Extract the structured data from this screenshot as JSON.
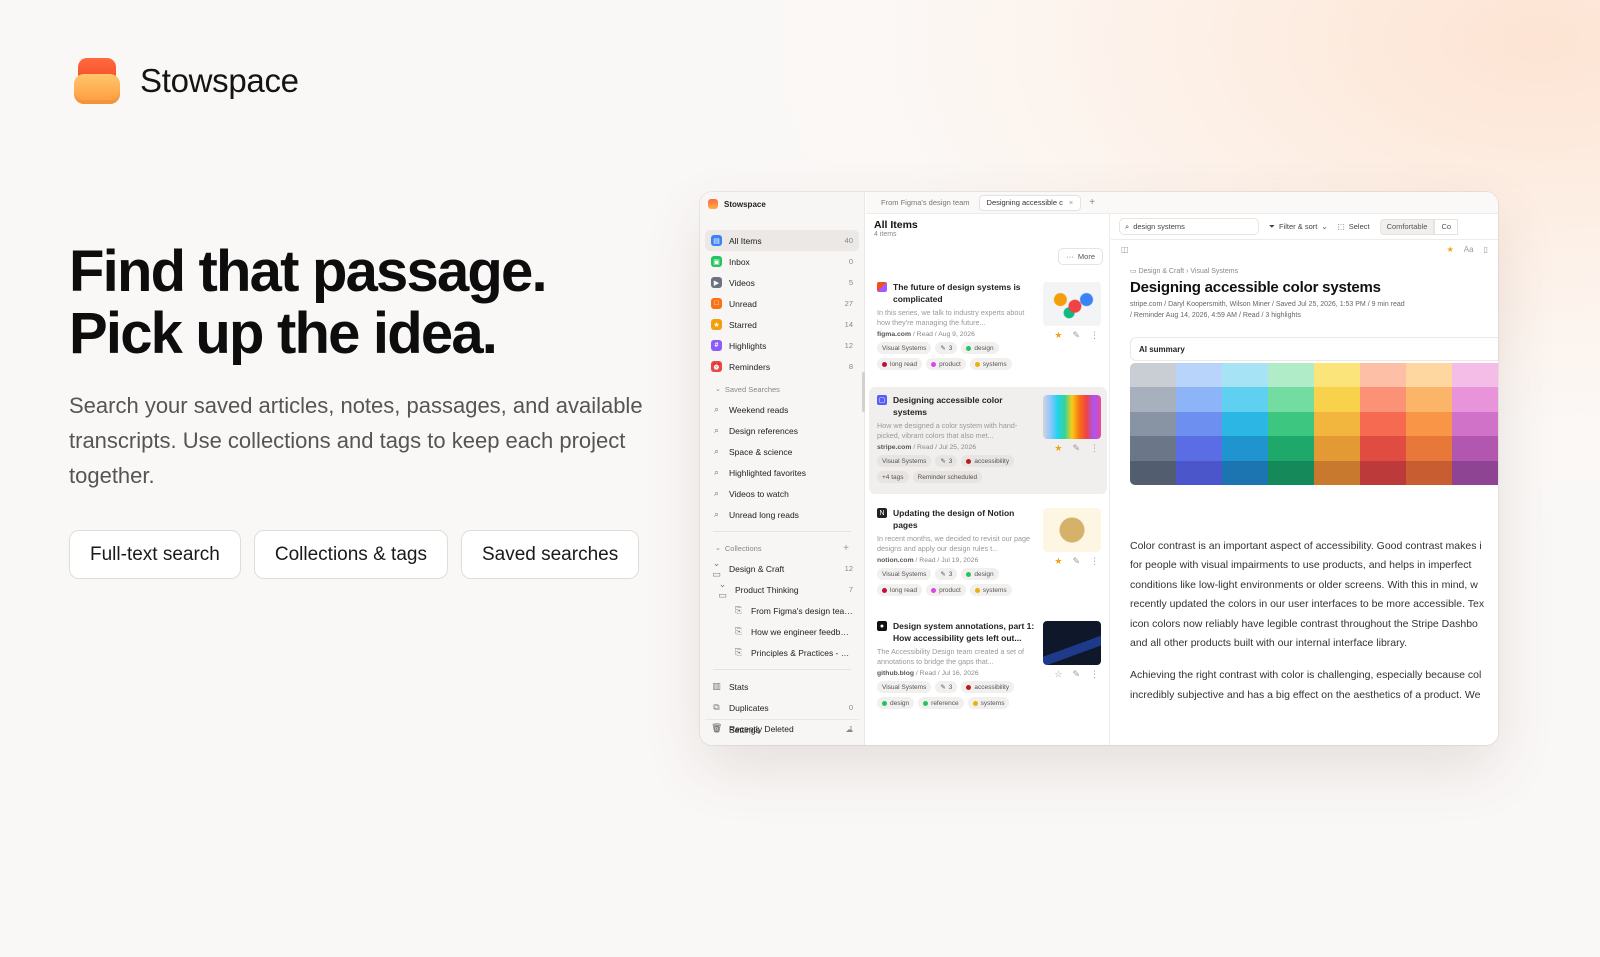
{
  "brand": {
    "name": "Stowspace"
  },
  "hero": {
    "line1": "Find that passage.",
    "line2": "Pick up the idea.",
    "subtitle": "Search your saved articles, notes, passages, and available transcripts. Use collections and tags to keep each project together.",
    "pills": [
      "Full-text search",
      "Collections & tags",
      "Saved searches"
    ]
  },
  "app": {
    "sidebar": {
      "title": "Stowspace",
      "items": [
        {
          "label": "All Items",
          "count": "40",
          "color": "#3b82f6",
          "glyph": "▤"
        },
        {
          "label": "Inbox",
          "count": "0",
          "color": "#22c55e",
          "glyph": "▣"
        },
        {
          "label": "Videos",
          "count": "5",
          "color": "#6b7280",
          "glyph": "▶"
        },
        {
          "label": "Unread",
          "count": "27",
          "color": "#f97316",
          "glyph": "□"
        },
        {
          "label": "Starred",
          "count": "14",
          "color": "#f59e0b",
          "glyph": "★"
        },
        {
          "label": "Highlights",
          "count": "12",
          "color": "#8b5cf6",
          "glyph": "#"
        },
        {
          "label": "Reminders",
          "count": "8",
          "color": "#ef4444",
          "glyph": "⏰"
        }
      ],
      "saved_section": "Saved Searches",
      "saved": [
        "Weekend reads",
        "Design references",
        "Space & science",
        "Highlighted favorites",
        "Videos to watch",
        "Unread long reads"
      ],
      "collections_section": "Collections",
      "collection": {
        "label": "Design & Craft",
        "count": "12"
      },
      "subcollection": {
        "label": "Product Thinking",
        "count": "7"
      },
      "docs": [
        "From Figma's design team:...",
        "How we engineer feedback...",
        "Principles & Practices - Line..."
      ],
      "utilities": [
        {
          "label": "Stats",
          "count": ""
        },
        {
          "label": "Duplicates",
          "count": "0"
        },
        {
          "label": "Recently Deleted",
          "count": "1"
        }
      ],
      "settings": "Settings"
    },
    "tabs": [
      "From Figma's design team",
      "Designing accessible c"
    ],
    "list": {
      "title": "All Items",
      "subtitle": "4 items",
      "more": "More",
      "cards": [
        {
          "title": "The future of design systems is complicated",
          "excerpt": "In this series, we talk to industry experts about how they're managing the future...",
          "domain": "figma.com",
          "meta": " / Read / Aug 9, 2026",
          "tags1": [
            {
              "t": "Visual Systems"
            },
            {
              "t": "3"
            },
            {
              "t": "design",
              "c": "#22c55e"
            }
          ],
          "tags2": [
            {
              "t": "long read",
              "c": "#be123c"
            },
            {
              "t": "product",
              "c": "#d946ef"
            },
            {
              "t": "systems",
              "c": "#eab308"
            }
          ],
          "starred": true
        },
        {
          "title": "Designing accessible color systems",
          "excerpt": "How we designed a color system with hand-picked, vibrant colors that also met...",
          "domain": "stripe.com",
          "meta": " / Read / Jul 25, 2026",
          "tags1": [
            {
              "t": "Visual Systems"
            },
            {
              "t": "3"
            },
            {
              "t": "accessibility",
              "c": "#b91c1c"
            }
          ],
          "tags2": [
            {
              "t": "+4 tags"
            },
            {
              "t": "Reminder scheduled"
            }
          ],
          "starred": true
        },
        {
          "title": "Updating the design of Notion pages",
          "excerpt": "In recent months, we decided to revisit our page designs and apply our design rules t...",
          "domain": "notion.com",
          "meta": " / Read / Jul 19, 2026",
          "tags1": [
            {
              "t": "Visual Systems"
            },
            {
              "t": "3"
            },
            {
              "t": "design",
              "c": "#22c55e"
            }
          ],
          "tags2": [
            {
              "t": "long read",
              "c": "#be123c"
            },
            {
              "t": "product",
              "c": "#d946ef"
            },
            {
              "t": "systems",
              "c": "#eab308"
            }
          ],
          "starred": true
        },
        {
          "title": "Design system annotations, part 1: How accessibility gets left out...",
          "excerpt": "The Accessibility Design team created a set of annotations to bridge the gaps that...",
          "domain": "github.blog",
          "meta": " / Read / Jul 16, 2026",
          "tags1": [
            {
              "t": "Visual Systems"
            },
            {
              "t": "3"
            },
            {
              "t": "accessibility",
              "c": "#b91c1c"
            }
          ],
          "tags2": [
            {
              "t": "design",
              "c": "#22c55e"
            },
            {
              "t": "reference",
              "c": "#22c55e"
            },
            {
              "t": "systems",
              "c": "#eab308"
            }
          ],
          "starred": false
        }
      ]
    },
    "reader": {
      "search_value": "design systems",
      "filter": "Filter & sort",
      "select": "Select",
      "view_on": "Comfortable",
      "view_next": "Co",
      "sub_aa": "Aa",
      "crumb1": "Design & Craft",
      "crumb2": "Visual Systems",
      "title": "Designing accessible color systems",
      "meta_line1": "stripe.com  /   Daryl Koopersmith, Wilson Miner  /   Saved Jul 25, 2026, 1:53 PM  /   9 min read",
      "meta_line2": "/   Reminder Aug 14, 2026, 4:59 AM   /   Read   /   3 highlights",
      "ai_label": "AI summary",
      "para1": [
        "Color contrast is an important aspect of accessibility. Good contrast makes i",
        "for people with visual impairments to use products, and helps in imperfect",
        "conditions like low-light environments or older screens. With this in mind, w",
        "recently updated the colors in our user interfaces to be more accessible. Tex",
        "icon colors now reliably have legible contrast throughout the Stripe Dashbo",
        "and all other products built with our internal interface library."
      ],
      "para2": [
        "Achieving the right contrast with color is challenging, especially because col",
        "incredibly subjective and has a big effect on the aesthetics of a product. We"
      ]
    }
  }
}
